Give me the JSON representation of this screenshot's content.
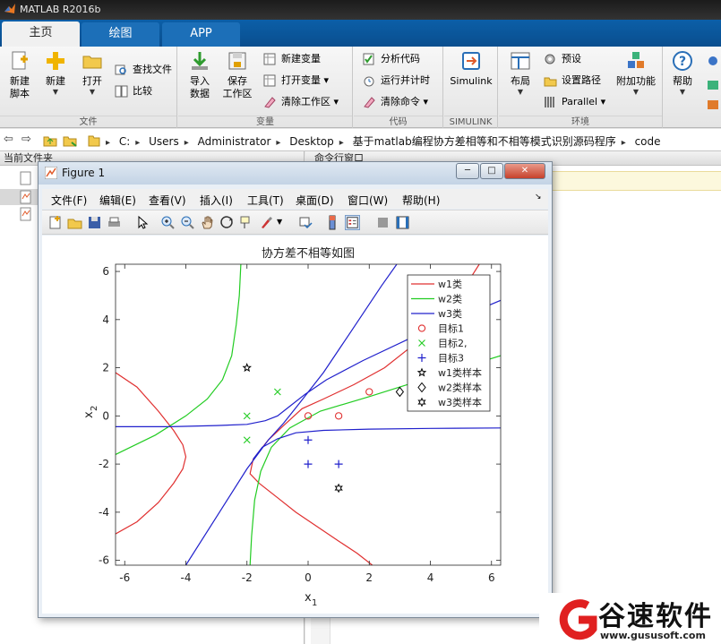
{
  "window": {
    "title": "MATLAB R2016b"
  },
  "tabs": [
    {
      "label": "主页",
      "active": true
    },
    {
      "label": "绘图",
      "active": false
    },
    {
      "label": "APP",
      "active": false
    }
  ],
  "ribbon": {
    "groups": {
      "file": "文件",
      "variable": "变量",
      "code": "代码",
      "simulink": "SIMULINK",
      "env": "环境"
    },
    "new_script": [
      "新建",
      "脚本"
    ],
    "new": "新建",
    "open": "打开",
    "find_files": "查找文件",
    "compare": "比较",
    "import": [
      "导入",
      "数据"
    ],
    "save_ws": [
      "保存",
      "工作区"
    ],
    "new_var": "新建变量",
    "open_var": "打开变量",
    "clear_ws": "清除工作区",
    "analyze": "分析代码",
    "run_time": "运行并计时",
    "clear_cmd": "清除命令",
    "simulink": "Simulink",
    "layout": "布局",
    "prefs": "预设",
    "set_path": "设置路径",
    "parallel": "Parallel",
    "addons": "附加功能",
    "help": "帮助"
  },
  "path": [
    "C:",
    "Users",
    "Administrator",
    "Desktop",
    "基于matlab编程协方差相等和不相等模式识别源码程序",
    "code"
  ],
  "panes": {
    "current_folder": "当前文件夹",
    "command_window": "命令行窗口"
  },
  "figure": {
    "title": "Figure 1",
    "menu": [
      "文件(F)",
      "编辑(E)",
      "查看(V)",
      "插入(I)",
      "工具(T)",
      "桌面(D)",
      "窗口(W)",
      "帮助(H)"
    ]
  },
  "chart_data": {
    "type": "line",
    "title": "协方差不相等如图",
    "xlabel": "x",
    "xlabel_sub": "1",
    "ylabel": "x",
    "ylabel_sub": "2",
    "xlim": [
      -6.3,
      6.3
    ],
    "ylim": [
      -6.2,
      6.3
    ],
    "xticks": [
      -6,
      -4,
      -2,
      0,
      2,
      4,
      6
    ],
    "yticks": [
      -6,
      -4,
      -2,
      0,
      2,
      4,
      6
    ],
    "grid": false,
    "legend_position": "top-right",
    "legend": [
      "w1类",
      "w2类",
      "w3类",
      "目标1",
      "目标2,",
      "目标3",
      "w1类样本",
      "w2类样本",
      "w3类样本"
    ],
    "colors": {
      "w1": "#e03030",
      "w2": "#22cc22",
      "w3": "#2020cc",
      "sample": "#000000"
    },
    "points": {
      "class1": [
        [
          0,
          0
        ],
        [
          1,
          0
        ],
        [
          2,
          1
        ]
      ],
      "class2": [
        [
          -2,
          0
        ],
        [
          -2,
          -1
        ],
        [
          -1,
          1
        ]
      ],
      "class3": [
        [
          0,
          -1
        ],
        [
          0,
          -2
        ],
        [
          1,
          -2
        ]
      ],
      "sample_w1": [
        -2,
        2
      ],
      "sample_w2": [
        3,
        1
      ],
      "sample_w3": [
        1,
        -3
      ]
    },
    "curves": {
      "w1_upper": [
        [
          -1.8,
          -1.8
        ],
        [
          -1.3,
          -1.0
        ],
        [
          -0.8,
          -0.4
        ],
        [
          -0.2,
          0.3
        ],
        [
          0.5,
          0.7
        ],
        [
          1.5,
          1.3
        ],
        [
          2.5,
          2.0
        ],
        [
          3.5,
          3.0
        ],
        [
          4.5,
          4.3
        ],
        [
          5.1,
          5.3
        ],
        [
          5.6,
          6.3
        ]
      ],
      "w1_lower": [
        [
          -1.8,
          -1.8
        ],
        [
          -1.9,
          -2.4
        ],
        [
          -1.6,
          -2.8
        ],
        [
          -1.0,
          -3.4
        ],
        [
          -0.4,
          -4.0
        ],
        [
          0.3,
          -4.6
        ],
        [
          1.0,
          -5.2
        ],
        [
          1.6,
          -5.7
        ],
        [
          2.1,
          -6.2
        ]
      ],
      "w1_left": [
        [
          -6.3,
          1.8
        ],
        [
          -5.6,
          1.2
        ],
        [
          -4.9,
          0.2
        ],
        [
          -4.4,
          -0.6
        ],
        [
          -4.1,
          -1.2
        ],
        [
          -4.0,
          -1.7
        ],
        [
          -4.1,
          -2.2
        ],
        [
          -4.4,
          -2.8
        ],
        [
          -4.9,
          -3.6
        ],
        [
          -5.6,
          -4.4
        ],
        [
          -6.3,
          -4.9
        ]
      ],
      "w2_top": [
        [
          -2.2,
          6.3
        ],
        [
          -2.25,
          5.0
        ],
        [
          -2.35,
          3.8
        ],
        [
          -2.5,
          2.5
        ],
        [
          -2.8,
          1.5
        ],
        [
          -3.3,
          0.7
        ],
        [
          -4.0,
          0.0
        ],
        [
          -5.0,
          -0.8
        ],
        [
          -6.3,
          -1.6
        ]
      ],
      "w2_right": [
        [
          -1.9,
          -6.2
        ],
        [
          -1.85,
          -5.0
        ],
        [
          -1.75,
          -3.5
        ],
        [
          -1.55,
          -2.3
        ],
        [
          -1.2,
          -1.3
        ],
        [
          -0.6,
          -0.5
        ],
        [
          0.4,
          0.2
        ],
        [
          2.0,
          0.8
        ],
        [
          4.0,
          1.6
        ],
        [
          6.3,
          2.5
        ]
      ],
      "w3_diag": [
        [
          -4.0,
          -6.2
        ],
        [
          -2.9,
          -4.0
        ],
        [
          -2.0,
          -2.2
        ],
        [
          -1.3,
          -1.0
        ],
        [
          -0.8,
          -0.3
        ],
        [
          -0.3,
          0.5
        ],
        [
          0.5,
          1.8
        ],
        [
          1.4,
          3.5
        ],
        [
          2.4,
          5.4
        ],
        [
          2.9,
          6.3
        ]
      ],
      "w3_left": [
        [
          -6.3,
          -0.45
        ],
        [
          -4.5,
          -0.45
        ],
        [
          -3.0,
          -0.4
        ],
        [
          -2.0,
          -0.35
        ],
        [
          -1.4,
          -0.2
        ],
        [
          -1.0,
          0.0
        ],
        [
          -0.6,
          0.4
        ],
        [
          -0.1,
          0.9
        ],
        [
          0.6,
          1.5
        ],
        [
          1.8,
          2.3
        ],
        [
          3.3,
          3.2
        ],
        [
          6.3,
          4.8
        ]
      ],
      "w3_right": [
        [
          -1.8,
          -1.8
        ],
        [
          -1.5,
          -1.3
        ],
        [
          -1.0,
          -0.95
        ],
        [
          -0.4,
          -0.7
        ],
        [
          0.5,
          -0.6
        ],
        [
          2.0,
          -0.55
        ],
        [
          4.0,
          -0.52
        ],
        [
          6.3,
          -0.5
        ]
      ]
    }
  },
  "watermark": {
    "brand": "谷速软件",
    "url": "www.gususoft.com"
  }
}
